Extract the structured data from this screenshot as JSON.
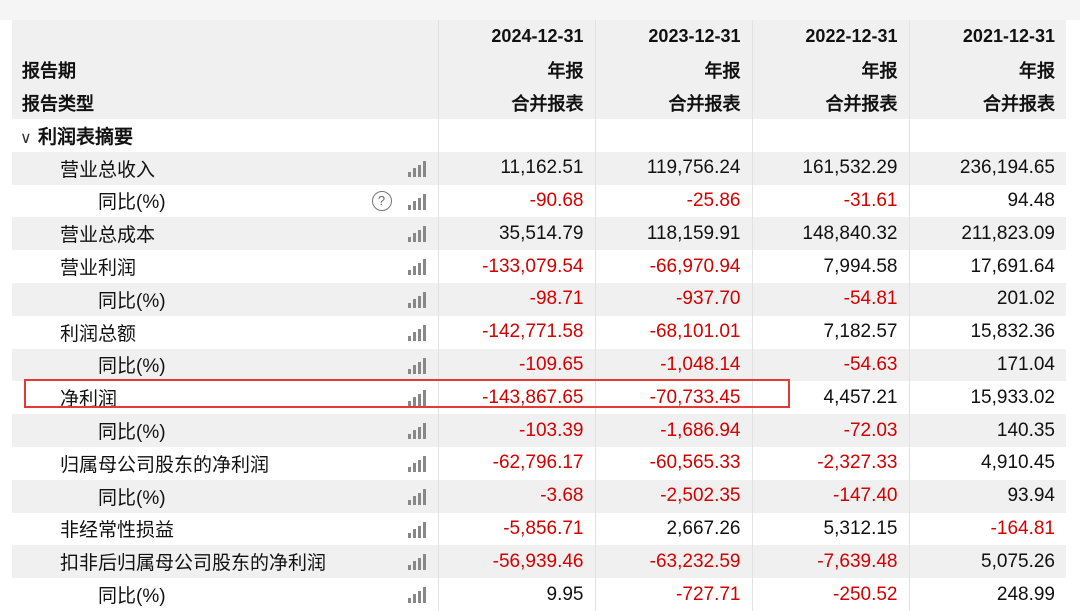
{
  "header": {
    "dates": [
      "2024-12-31",
      "2023-12-31",
      "2022-12-31",
      "2021-12-31"
    ],
    "period_label": "报告期",
    "period_values": [
      "年报",
      "年报",
      "年报",
      "年报"
    ],
    "type_label": "报告类型",
    "type_values": [
      "合并报表",
      "合并报表",
      "合并报表",
      "合并报表"
    ]
  },
  "section": {
    "chevron": "∨",
    "title": "利润表摘要"
  },
  "rows": [
    {
      "label": "营业总收入",
      "values": [
        "11,162.51",
        "119,756.24",
        "161,532.29",
        "236,194.65"
      ]
    },
    {
      "label": "同比(%)",
      "values": [
        "-90.68",
        "-25.86",
        "-31.61",
        "94.48"
      ]
    },
    {
      "label": "营业总成本",
      "values": [
        "35,514.79",
        "118,159.91",
        "148,840.32",
        "211,823.09"
      ]
    },
    {
      "label": "营业利润",
      "values": [
        "-133,079.54",
        "-66,970.94",
        "7,994.58",
        "17,691.64"
      ]
    },
    {
      "label": "同比(%)",
      "values": [
        "-98.71",
        "-937.70",
        "-54.81",
        "201.02"
      ]
    },
    {
      "label": "利润总额",
      "values": [
        "-142,771.58",
        "-68,101.01",
        "7,182.57",
        "15,832.36"
      ]
    },
    {
      "label": "同比(%)",
      "values": [
        "-109.65",
        "-1,048.14",
        "-54.63",
        "171.04"
      ]
    },
    {
      "label": "净利润",
      "values": [
        "-143,867.65",
        "-70,733.45",
        "4,457.21",
        "15,933.02"
      ]
    },
    {
      "label": "同比(%)",
      "values": [
        "-103.39",
        "-1,686.94",
        "-72.03",
        "140.35"
      ]
    },
    {
      "label": "归属母公司股东的净利润",
      "values": [
        "-62,796.17",
        "-60,565.33",
        "-2,327.33",
        "4,910.45"
      ]
    },
    {
      "label": "同比(%)",
      "values": [
        "-3.68",
        "-2,502.35",
        "-147.40",
        "93.94"
      ]
    },
    {
      "label": "非经常性损益",
      "values": [
        "-5,856.71",
        "2,667.26",
        "5,312.15",
        "-164.81"
      ]
    },
    {
      "label": "扣非后归属母公司股东的净利润",
      "values": [
        "-56,939.46",
        "-63,232.59",
        "-7,639.48",
        "5,075.26"
      ]
    },
    {
      "label": "同比(%)",
      "values": [
        "9.95",
        "-727.71",
        "-250.52",
        "248.99"
      ]
    }
  ],
  "icons": {
    "chart": "bar-chart-icon",
    "help": "question-circle-icon",
    "help_glyph": "?"
  },
  "colors": {
    "negative": "#d40000",
    "positive": "#111111",
    "stripe": "#f0f0f0",
    "highlight_box": "#e53935"
  }
}
